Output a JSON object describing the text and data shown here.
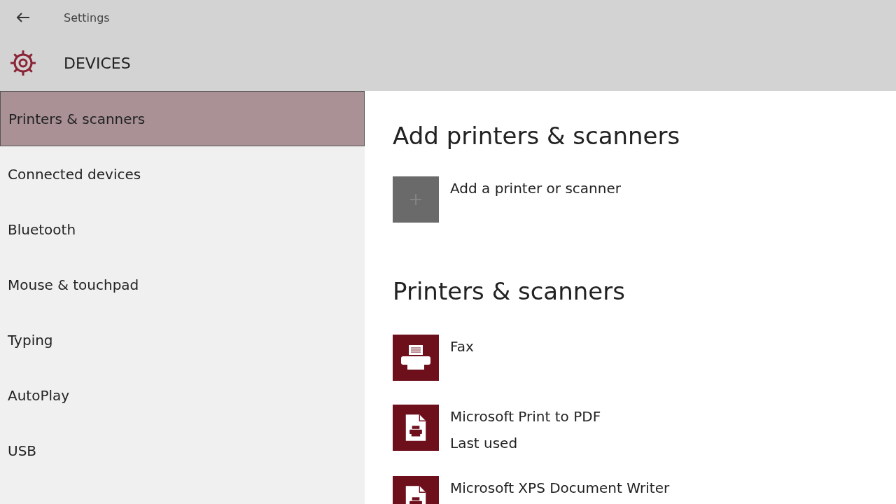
{
  "window": {
    "title": "Settings"
  },
  "header": {
    "title": "DEVICES"
  },
  "sidebar": {
    "items": [
      {
        "label": "Printers & scanners",
        "selected": true
      },
      {
        "label": "Connected devices",
        "selected": false
      },
      {
        "label": "Bluetooth",
        "selected": false
      },
      {
        "label": "Mouse & touchpad",
        "selected": false
      },
      {
        "label": "Typing",
        "selected": false
      },
      {
        "label": "AutoPlay",
        "selected": false
      },
      {
        "label": "USB",
        "selected": false
      }
    ]
  },
  "add_section": {
    "heading": "Add printers & scanners",
    "action": "Add a printer or scanner"
  },
  "printers_section": {
    "heading": "Printers & scanners",
    "devices": [
      {
        "kind": "printer",
        "name": "Fax"
      },
      {
        "kind": "document",
        "name": "Microsoft Print to PDF",
        "status": "Last used"
      },
      {
        "kind": "document",
        "name": "Microsoft XPS Document Writer"
      }
    ]
  }
}
